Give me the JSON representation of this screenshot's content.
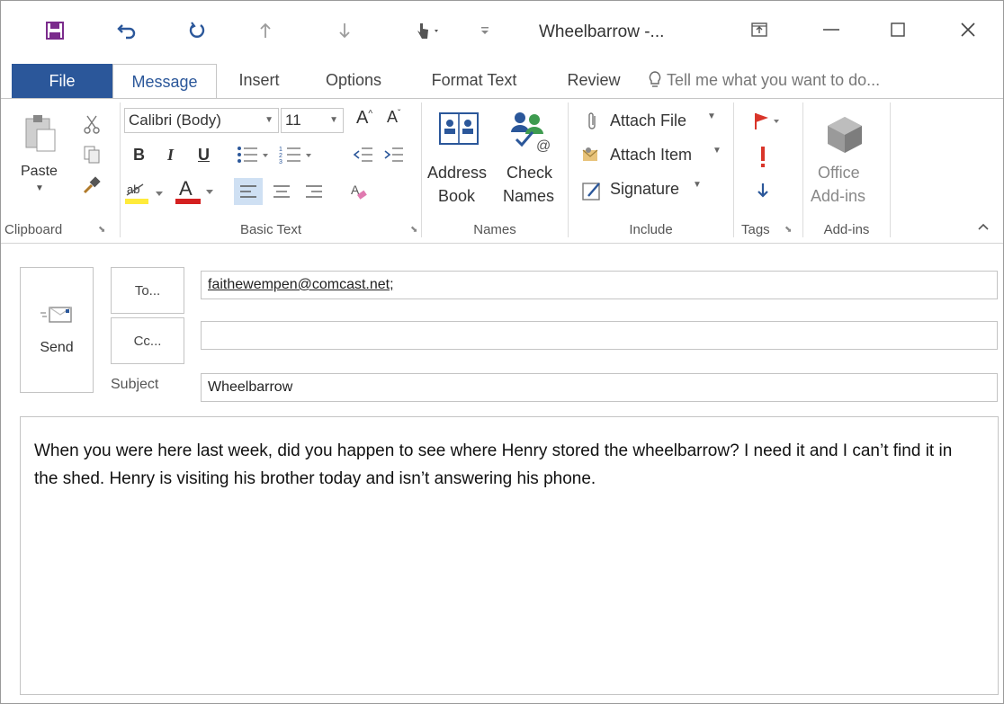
{
  "window": {
    "title": "Wheelbarrow -...",
    "quick_access": [
      "save-icon",
      "undo-icon",
      "redo-icon",
      "previous-item-icon",
      "next-item-icon",
      "touch-mode-icon",
      "customize-qat-icon"
    ],
    "controls": [
      "ribbon-display-options-icon",
      "minimize-icon",
      "maximize-icon",
      "close-icon"
    ]
  },
  "tabs": {
    "file": "File",
    "message": "Message",
    "insert": "Insert",
    "options": "Options",
    "format_text": "Format Text",
    "review": "Review",
    "tell_me": "Tell me what you want to do..."
  },
  "ribbon": {
    "clipboard": {
      "label": "Clipboard",
      "paste": "Paste"
    },
    "basic_text": {
      "label": "Basic Text",
      "font_name": "Calibri (Body)",
      "font_size": "11",
      "bold": "B",
      "italic": "I",
      "underline": "U",
      "font_color": "A"
    },
    "names": {
      "label": "Names",
      "address_line1": "Address",
      "address_line2": "Book",
      "check_line1": "Check",
      "check_line2": "Names"
    },
    "include": {
      "label": "Include",
      "attach_file": "Attach File",
      "attach_item": "Attach Item",
      "signature": "Signature"
    },
    "tags": {
      "label": "Tags"
    },
    "addins": {
      "label": "Add-ins",
      "office_line1": "Office",
      "office_line2": "Add-ins"
    }
  },
  "message": {
    "send": "Send",
    "to_button": "To...",
    "cc_button": "Cc...",
    "to_value": "faithewempen@comcast.net;",
    "cc_value": "",
    "subject_label": "Subject",
    "subject_value": "Wheelbarrow",
    "body": "When you were here last week, did you happen to see where Henry stored the wheelbarrow? I need it and I can’t find it in the shed. Henry is visiting his brother today and isn’t answering his phone."
  },
  "colors": {
    "accent": "#2b579a",
    "flag_red": "#d9352a",
    "highlight_yellow": "#ffeb3b",
    "font_color_red": "#d42020"
  }
}
